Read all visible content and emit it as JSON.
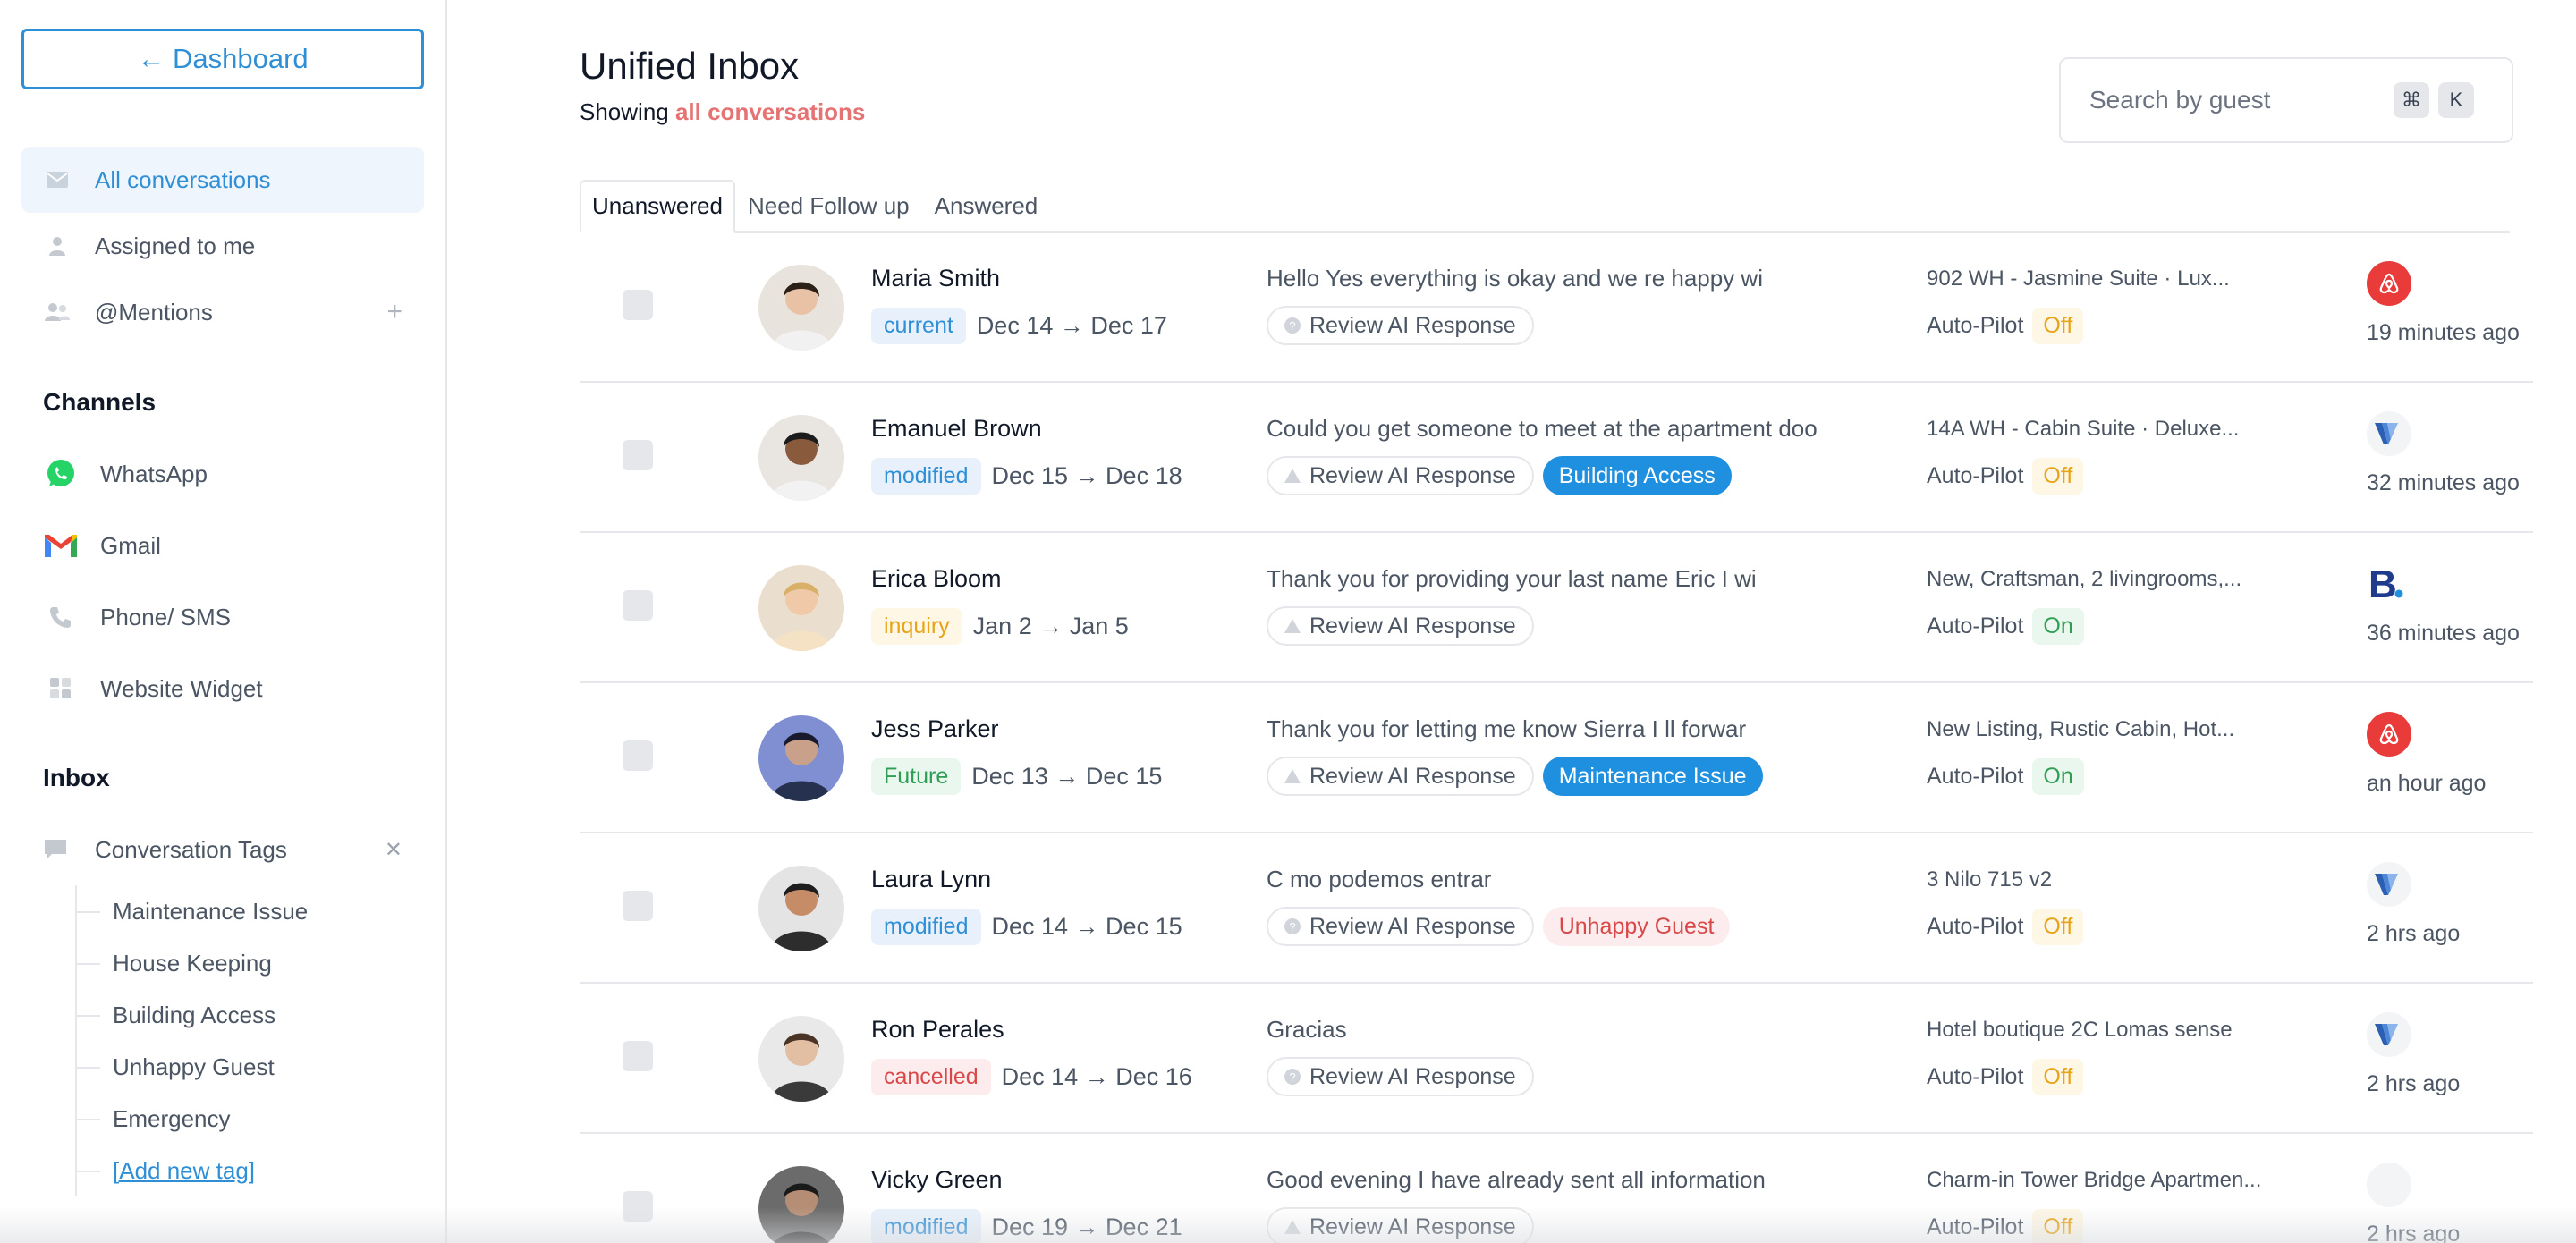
{
  "sidebar": {
    "dashboard_label": "← Dashboard",
    "nav": [
      {
        "label": "All conversations",
        "icon": "mail-icon"
      },
      {
        "label": "Assigned to me",
        "icon": "user-icon"
      },
      {
        "label": "@Mentions",
        "icon": "users-icon"
      }
    ],
    "channels_title": "Channels",
    "channels": [
      {
        "label": "WhatsApp",
        "icon": "whatsapp-icon"
      },
      {
        "label": "Gmail",
        "icon": "gmail-icon"
      },
      {
        "label": "Phone/ SMS",
        "icon": "phone-icon"
      },
      {
        "label": "Website Widget",
        "icon": "widget-icon"
      }
    ],
    "inbox_title": "Inbox",
    "tags_title": "Conversation Tags",
    "tags": [
      "Maintenance Issue",
      "House Keeping",
      "Building Access",
      "Unhappy Guest",
      "Emergency"
    ],
    "add_tag": "[Add new tag]"
  },
  "header": {
    "title": "Unified Inbox",
    "showing_prefix": "Showing",
    "showing_value": "all conversations",
    "search_placeholder": "Search by guest",
    "kbd_cmd": "⌘",
    "kbd_k": "K"
  },
  "tabs": [
    "Unanswered",
    "Need Follow up",
    "Answered"
  ],
  "conversations": [
    {
      "name": "Maria Smith",
      "status": "current",
      "dates": "Dec 14 → Dec 17",
      "message": "Hello Yes everything is okay and we re happy wi",
      "review": "Review AI Response",
      "tag": "",
      "property": "902 WH - Jasmine Suite · Lux...",
      "autopilot_label": "Auto-Pilot",
      "autopilot": "Off",
      "platform": "airbnb",
      "time": "19 minutes ago"
    },
    {
      "name": "Emanuel Brown",
      "status": "modified",
      "dates": "Dec 15 → Dec 18",
      "message": "Could you get someone to meet at the apartment doo",
      "review": "Review AI Response",
      "tag": "Building Access",
      "property": "14A WH - Cabin Suite · Deluxe...",
      "autopilot_label": "Auto-Pilot",
      "autopilot": "Off",
      "platform": "vrbo",
      "time": "32 minutes ago"
    },
    {
      "name": "Erica Bloom",
      "status": "inquiry",
      "dates": "Jan 2 → Jan 5",
      "message": "Thank you for providing your last name Eric I wi",
      "review": "Review AI Response",
      "tag": "",
      "property": "New, Craftsman, 2 livingrooms,...",
      "autopilot_label": "Auto-Pilot",
      "autopilot": "On",
      "platform": "booking",
      "time": "36 minutes ago"
    },
    {
      "name": "Jess Parker",
      "status": "Future",
      "dates": "Dec 13 → Dec 15",
      "message": "Thank you for letting me know Sierra I ll forwar",
      "review": "Review AI Response",
      "tag": "Maintenance Issue",
      "property": "New Listing, Rustic Cabin, Hot...",
      "autopilot_label": "Auto-Pilot",
      "autopilot": "On",
      "platform": "airbnb",
      "time": "an hour ago"
    },
    {
      "name": "Laura Lynn",
      "status": "modified",
      "dates": "Dec 14 → Dec 15",
      "message": "C mo podemos entrar",
      "review": "Review AI Response",
      "tag": "Unhappy Guest",
      "property": "3 Nilo 715 v2",
      "autopilot_label": "Auto-Pilot",
      "autopilot": "Off",
      "platform": "vrbo",
      "time": "2 hrs ago"
    },
    {
      "name": "Ron Perales",
      "status": "cancelled",
      "dates": "Dec 14 → Dec 16",
      "message": "Gracias",
      "review": "Review AI Response",
      "tag": "",
      "property": "Hotel boutique 2C Lomas sense",
      "autopilot_label": "Auto-Pilot",
      "autopilot": "Off",
      "platform": "vrbo",
      "time": "2 hrs ago"
    },
    {
      "name": "Vicky Green",
      "status": "modified",
      "dates": "Dec 19 → Dec 21",
      "message": "Good evening I have already sent all information",
      "review": "Review AI Response",
      "tag": "",
      "property": "Charm-in Tower Bridge Apartmen...",
      "autopilot_label": "Auto-Pilot",
      "autopilot": "Off",
      "platform": "blank",
      "time": "2 hrs ago"
    }
  ],
  "colors": {
    "accent": "#2f8fd6",
    "tag_blue": "#1f8fdf",
    "airbnb": "#ea3b3b",
    "highlight": "#e57373"
  }
}
